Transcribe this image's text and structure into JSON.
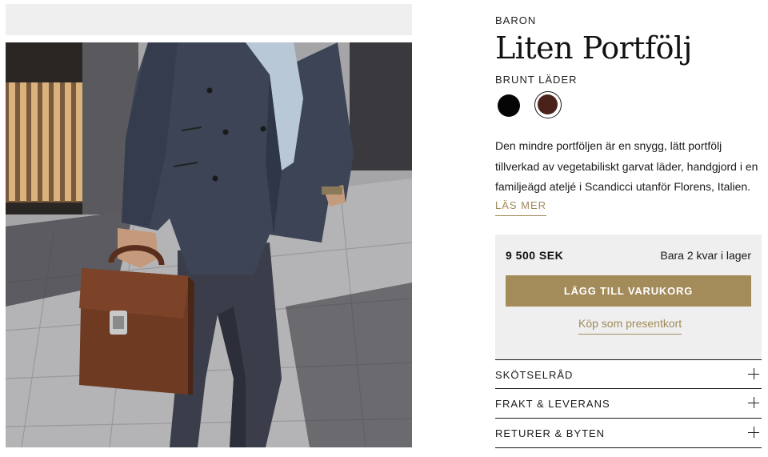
{
  "product": {
    "brand": "BARON",
    "title": "Liten Portfölj",
    "variant_label": "BRUNT LÄDER",
    "swatches": [
      {
        "name": "black",
        "color": "#050505"
      },
      {
        "name": "brown",
        "color": "#4a2219",
        "selected": true
      }
    ],
    "description": "Den mindre portföljen är en snygg, lätt portfölj tillverkad av vegetabiliskt garvat läder, handgjord i en familjeägd ateljé i Scandicci utanför Florens, Italien.",
    "read_more": "LÄS MER"
  },
  "buy_box": {
    "price": "9 500 SEK",
    "stock": "Bara 2 kvar i lager",
    "add_to_cart": "LÄGG TILL VARUKORG",
    "gift_card": "Köp som presentkort"
  },
  "accordion": [
    {
      "label": "SKÖTSELRÅD",
      "icon": "plus-icon"
    },
    {
      "label": "FRAKT & LEVERANS",
      "icon": "plus-icon"
    },
    {
      "label": "RETURER & BYTEN",
      "icon": "plus-icon"
    }
  ],
  "colors": {
    "accent": "#a48b5a",
    "link": "#a08a5a",
    "buybox_bg": "#efefef"
  }
}
